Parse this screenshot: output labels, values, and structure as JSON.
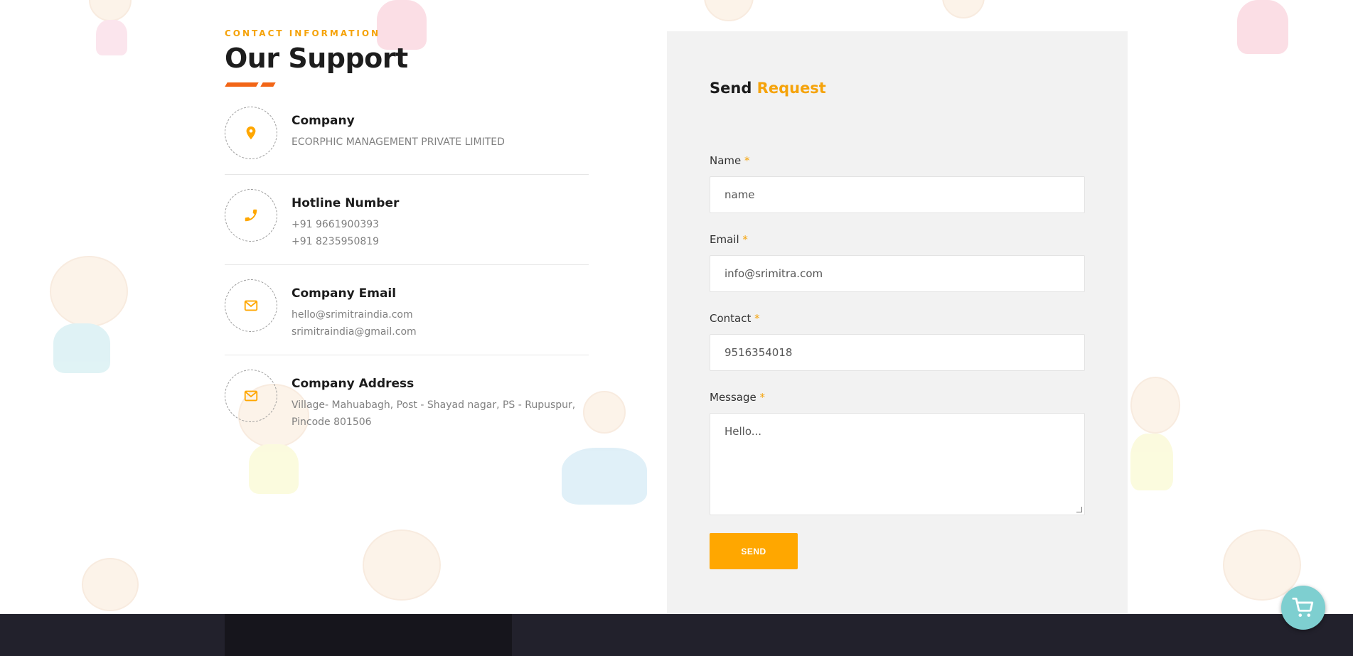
{
  "contact": {
    "eyebrow": "CONTACT INFORMATION",
    "title": "Our Support",
    "items": [
      {
        "icon": "map-pin-icon",
        "title": "Company",
        "lines": [
          "ECORPHIC MANAGEMENT PRIVATE LIMITED"
        ]
      },
      {
        "icon": "phone-icon",
        "title": "Hotline Number",
        "lines": [
          "+91 9661900393",
          "+91 8235950819"
        ]
      },
      {
        "icon": "envelope-icon",
        "title": "Company Email",
        "lines": [
          "hello@srimitraindia.com",
          "srimitraindia@gmail.com"
        ]
      },
      {
        "icon": "envelope-icon",
        "title": "Company Address",
        "lines": [
          "Village- Mahuabagh, Post - Shayad nagar, PS - Rupuspur,",
          "Pincode 801506"
        ]
      }
    ]
  },
  "form": {
    "title_plain": "Send",
    "title_accent": "Request",
    "required_mark": "*",
    "fields": {
      "name": {
        "label": "Name",
        "placeholder": "name"
      },
      "email": {
        "label": "Email",
        "placeholder": "info@srimitra.com"
      },
      "contact": {
        "label": "Contact",
        "placeholder": "9516354018"
      },
      "message": {
        "label": "Message",
        "placeholder": "Hello..."
      }
    },
    "submit_label": "SEND"
  },
  "floating": {
    "icon": "shopping-cart-icon"
  },
  "colors": {
    "accent": "#ffa700",
    "underline": "#f26516",
    "panel_bg": "#f2f2f2",
    "footer_bg": "#22212c",
    "cart_bg": "#7ecfd0"
  }
}
